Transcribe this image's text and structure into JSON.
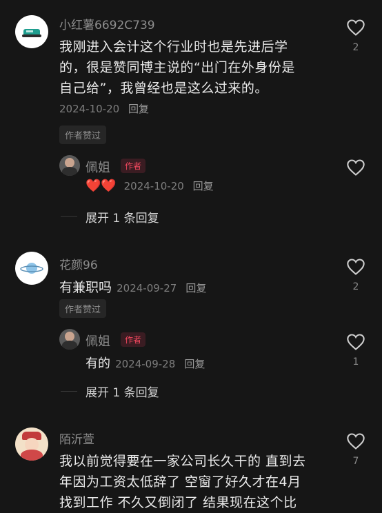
{
  "comments": [
    {
      "username": "小红薯6692C739",
      "text_lines": [
        "我刚进入会计这个行业时也是先进后学",
        "的，很是赞同博主说的“出门在外身份是",
        "自己给”，我曾经也是这么过来的。"
      ],
      "date": "2024-10-20",
      "reply_label": "回复",
      "chip": "作者赞过",
      "likes": "2",
      "reply": {
        "username": "佩姐",
        "tag": "作者",
        "emoji": "❤️❤️",
        "date": "2024-10-20",
        "reply_label": "回复"
      },
      "expand": "展开 1 条回复"
    },
    {
      "username": "花颜96",
      "text": "有兼职吗",
      "date": "2024-09-27",
      "reply_label": "回复",
      "chip": "作者赞过",
      "likes": "2",
      "reply": {
        "username": "佩姐",
        "tag": "作者",
        "text": "有的",
        "date": "2024-09-28",
        "reply_label": "回复",
        "likes": "1"
      },
      "expand": "展开 1 条回复"
    },
    {
      "username": "陌沂萱",
      "text_lines": [
        "我以前觉得要在一家公司长久干的 直到去",
        "年因为工资太低辞了 空窗了好久才在4月",
        "找到工作 不久又倒闭了 结果现在这个比"
      ],
      "likes": "7"
    }
  ],
  "colors": {
    "background": "#161616",
    "author_tag": "#f2485e",
    "heart": "#ff3b5c"
  }
}
